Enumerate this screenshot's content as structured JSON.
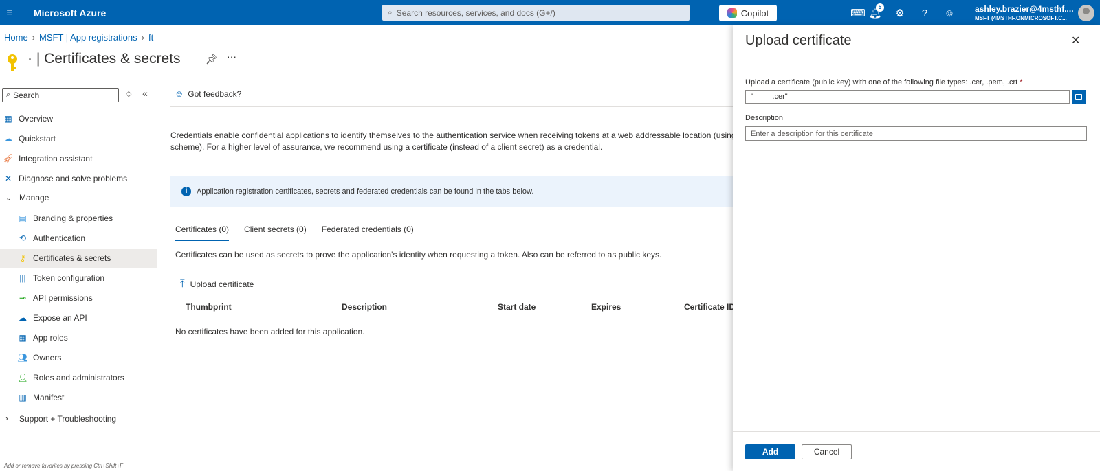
{
  "topbar": {
    "brand": "Microsoft Azure",
    "search_placeholder": "Search resources, services, and docs (G+/)",
    "copilot_label": "Copilot",
    "notification_count": "5",
    "account_name": "ashley.brazier@4msthf....",
    "account_tenant": "MSFT (4MSTHF.ONMICROSOFT.C..."
  },
  "breadcrumb": [
    "Home",
    "MSFT | App registrations",
    "ft"
  ],
  "page": {
    "title_prefix": "·",
    "title": "| Certificates & secrets"
  },
  "nav": {
    "search_placeholder": "Search",
    "items_top": [
      {
        "label": "Overview",
        "icon": "grid-icon"
      },
      {
        "label": "Quickstart",
        "icon": "cloud-icon"
      },
      {
        "label": "Integration assistant",
        "icon": "rocket-icon"
      },
      {
        "label": "Diagnose and solve problems",
        "icon": "wrench-icon"
      }
    ],
    "manage_label": "Manage",
    "manage_items": [
      {
        "label": "Branding & properties",
        "icon": "branding-icon"
      },
      {
        "label": "Authentication",
        "icon": "authentication-icon"
      },
      {
        "label": "Certificates & secrets",
        "icon": "key-icon"
      },
      {
        "label": "Token configuration",
        "icon": "token-icon"
      },
      {
        "label": "API permissions",
        "icon": "api-permissions-icon"
      },
      {
        "label": "Expose an API",
        "icon": "cloud-api-icon"
      },
      {
        "label": "App roles",
        "icon": "app-roles-icon"
      },
      {
        "label": "Owners",
        "icon": "owners-icon"
      },
      {
        "label": "Roles and administrators",
        "icon": "roles-icon"
      },
      {
        "label": "Manifest",
        "icon": "manifest-icon"
      }
    ],
    "support_label": "Support + Troubleshooting",
    "footer_hint": "Add or remove favorites by pressing Ctrl+Shift+F"
  },
  "content": {
    "feedback_label": "Got feedback?",
    "description_line1": "Credentials enable confidential applications to identify themselves to the authentication service when receiving tokens at a web addressable location (using a",
    "description_line2": "scheme). For a higher level of assurance, we recommend using a certificate (instead of a client secret) as a credential.",
    "info_banner": "Application registration certificates, secrets and federated credentials can be found in the tabs below.",
    "tabs": [
      "Certificates (0)",
      "Client secrets (0)",
      "Federated credentials (0)"
    ],
    "tab_description": "Certificates can be used as secrets to prove the application's identity when requesting a token. Also can be referred to as public keys.",
    "upload_action": "Upload certificate",
    "table_headers": [
      "Thumbprint",
      "Description",
      "Start date",
      "Expires",
      "Certificate ID"
    ],
    "empty_message": "No certificates have been added for this application."
  },
  "blade": {
    "title": "Upload certificate",
    "file_label": "Upload a certificate (public key) with one of the following file types: .cer, .pem, .crt",
    "required_marker": "*",
    "file_value": "\"         .cer\"",
    "description_label": "Description",
    "description_placeholder": "Enter a description for this certificate",
    "add_label": "Add",
    "cancel_label": "Cancel"
  }
}
